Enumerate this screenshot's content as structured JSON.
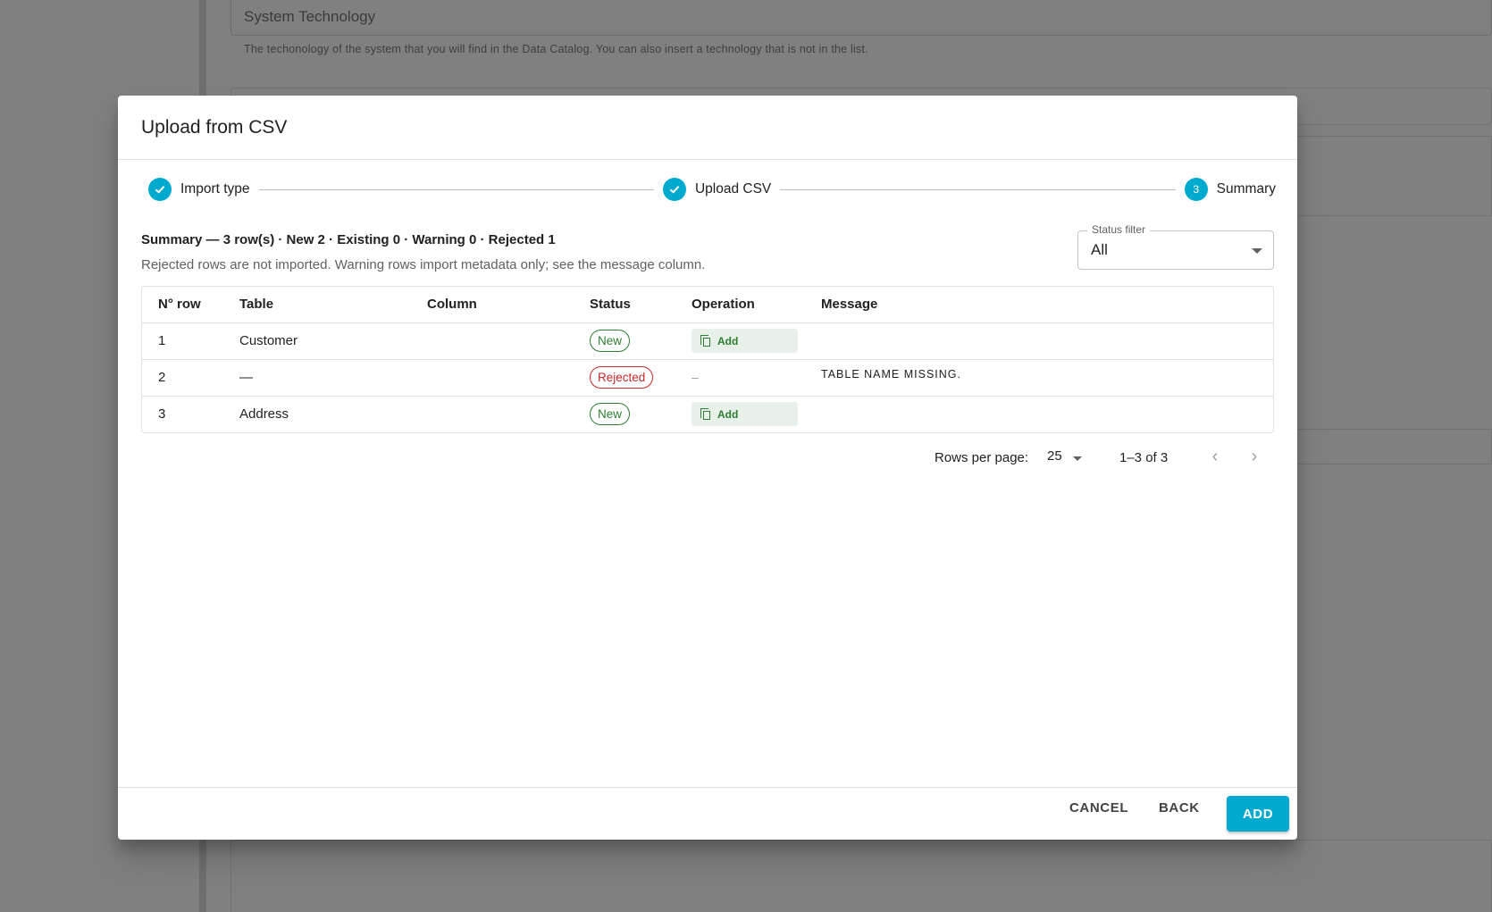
{
  "background": {
    "field_value": "System Technology",
    "field_help": "The techonology of the system that you will find in the Data Catalog. You can also insert a technology that is not in the list."
  },
  "modal": {
    "title": "Upload from CSV",
    "steps": [
      {
        "label": "Import type",
        "state": "completed"
      },
      {
        "label": "Upload CSV",
        "state": "completed"
      },
      {
        "label": "Summary",
        "number": "3",
        "state": "active"
      }
    ],
    "summary_title": "Summary — 3 row(s) · New 2 · Existing 0 · Warning 0 · Rejected 1",
    "summary_note": "Rejected rows are not imported. Warning rows import metadata only; see the message column.",
    "status_filter": {
      "legend": "Status filter",
      "value": "All"
    },
    "table": {
      "headers": [
        "N° row",
        "Table",
        "Column",
        "Status",
        "Operation",
        "Message"
      ],
      "rows": [
        {
          "n": "1",
          "table": "Customer",
          "column": "",
          "status": "New",
          "operation": "Add",
          "message": ""
        },
        {
          "n": "2",
          "table": "—",
          "column": "",
          "status": "Rejected",
          "operation": "–",
          "message": "Table name missing."
        },
        {
          "n": "3",
          "table": "Address",
          "column": "",
          "status": "New",
          "operation": "Add",
          "message": ""
        }
      ]
    },
    "pagination": {
      "rows_per_page_label": "Rows per page:",
      "rows_per_page": "25",
      "range": "1–3 of 3"
    },
    "footer": {
      "cancel": "CANCEL",
      "back": "BACK",
      "add": "ADD"
    }
  },
  "colors": {
    "accent": "#00a9ce",
    "new": "#2e7d32",
    "rejected": "#c62828"
  }
}
